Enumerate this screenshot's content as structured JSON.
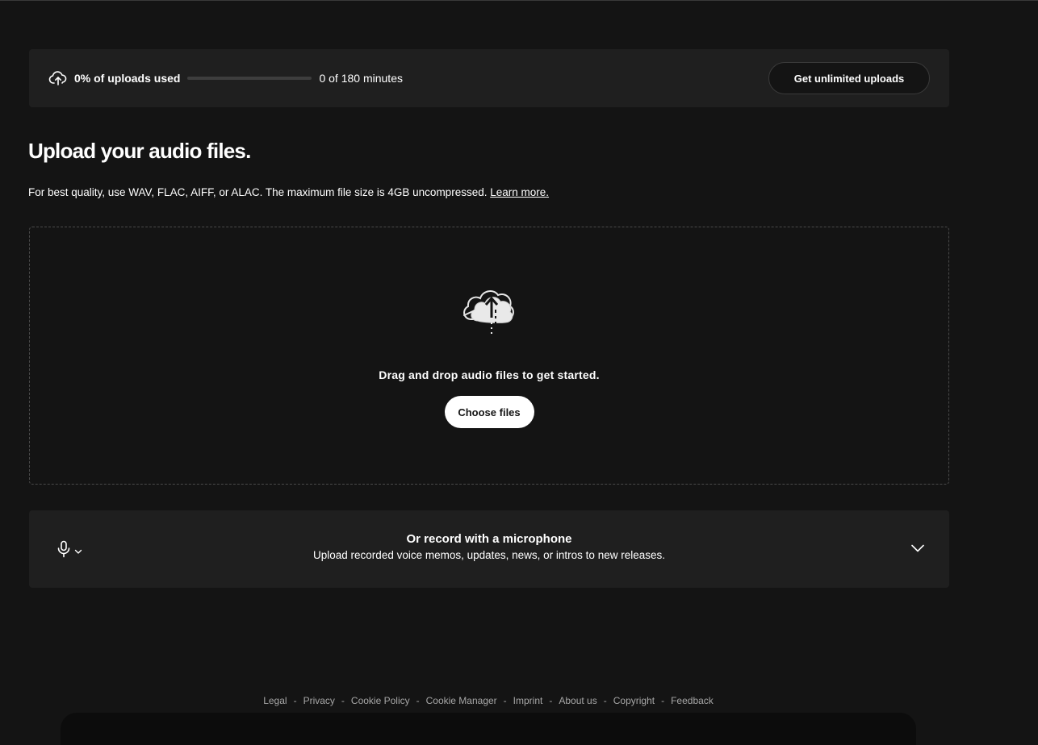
{
  "usage": {
    "label": "0% of uploads used",
    "progress_fraction": 0,
    "minutes_text": "0 of 180 minutes",
    "upgrade_button": "Get unlimited uploads"
  },
  "upload": {
    "title": "Upload your audio files.",
    "description": "For best quality, use WAV, FLAC, AIFF, or ALAC. The maximum file size is 4GB uncompressed.",
    "learn_more": "Learn more.",
    "drop_text": "Drag and drop audio files to get started.",
    "choose_button": "Choose files"
  },
  "record": {
    "title": "Or record with a microphone",
    "subtitle": "Upload recorded voice memos, updates, news, or intros to new releases."
  },
  "footer": {
    "links": [
      "Legal",
      "Privacy",
      "Cookie Policy",
      "Cookie Manager",
      "Imprint",
      "About us",
      "Copyright",
      "Feedback"
    ],
    "separator": "-"
  },
  "icons": {
    "usage": "cloud-upload-icon",
    "illustration": "cloud-upload-illustration",
    "mic": "microphone-icon",
    "mic_chevron": "chevron-down-icon",
    "expand": "chevron-down-icon"
  },
  "colors": {
    "background": "#141414",
    "panel": "#1f1f1f",
    "text": "#ffffff",
    "muted": "#a7a7a7"
  }
}
